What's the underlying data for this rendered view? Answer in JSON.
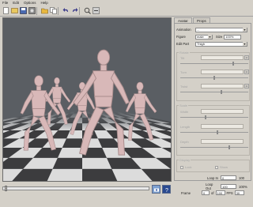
{
  "menu": [
    "File",
    "Edit",
    "Options",
    "Help"
  ],
  "toolbar": {
    "buttons": [
      "new-icon",
      "open-icon",
      "save-icon",
      "export-icon",
      "folder-icon",
      "copy-icon",
      "undo-icon",
      "redo-icon",
      "zoom-in-icon",
      "zoom-out-icon"
    ]
  },
  "viewport": {
    "background": "#5a5e63",
    "floor_light": "#dcdcdc",
    "floor_dark": "#3c3c3e",
    "figure_color": "#d8b8b8"
  },
  "timeline": {
    "position": 0.01
  },
  "panel": {
    "tabs": [
      "Avatar",
      "Props"
    ],
    "animation": {
      "label": "Animation",
      "value": "..."
    },
    "figure": {
      "label": "Figure",
      "value": "male",
      "size_label": "Size",
      "size_value": "100%"
    },
    "edit_part": {
      "label": "Edit Part",
      "value": "Thigh"
    },
    "groups": {
      "rotate": {
        "title": "Rotate",
        "controls": [
          {
            "label": "Tilt",
            "slider": 0.78
          },
          {
            "label": "Turn",
            "slider": 0.5
          },
          {
            "label": "Twist",
            "slider": 0.61
          }
        ]
      },
      "scale": {
        "title": "Scale",
        "controls": [
          {
            "label": "Width",
            "slider": 0.37
          },
          {
            "label": "Length",
            "slider": 0.55
          },
          {
            "label": "Depth",
            "slider": 0.72
          }
        ]
      },
      "display": {
        "title": "Display",
        "checkboxes": [
          "Lock",
          "Show"
        ]
      }
    }
  },
  "footer": {
    "loop_in_label": "Loop In",
    "loop_in_value": "0",
    "loop_in_end": "100",
    "loop_out_label": "Loop Out",
    "loop_out_value": "100",
    "loop_out_end": "100%",
    "frame_label": "Frame",
    "frame_value": "0",
    "of_label": "of",
    "total_frames": "100",
    "fps_label": "FPS",
    "fps_value": "30"
  }
}
